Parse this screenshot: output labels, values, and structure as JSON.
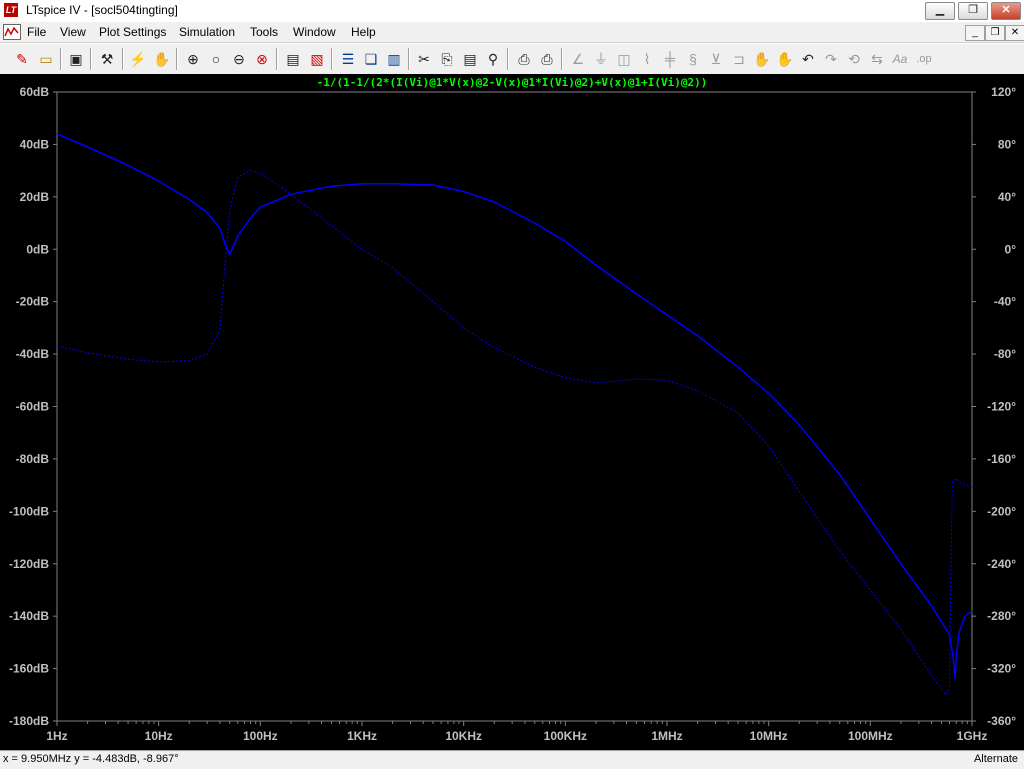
{
  "window": {
    "title": "LTspice IV - [socl504tingting]",
    "logo": "LT",
    "minimize": "▁",
    "maximize": "❐",
    "close": "✕"
  },
  "menu": {
    "file": "File",
    "view": "View",
    "plot_settings": "Plot Settings",
    "simulation": "Simulation",
    "tools": "Tools",
    "window": "Window",
    "help": "Help",
    "mdi_min": "_",
    "mdi_restore": "❐",
    "mdi_close": "✕"
  },
  "toolbar": {
    "icons": [
      "new-schematic-icon",
      "open-icon",
      "save-icon",
      "control-panel-icon",
      "run-icon",
      "halt-icon",
      "zoom-area-icon",
      "zoom-back-icon",
      "zoom-out-icon",
      "zoom-cancel-icon",
      "autorange-icon",
      "pan-icon",
      "tile-horizontal-icon",
      "cascade-icon",
      "tile-vertical-icon",
      "cut-icon",
      "copy-icon",
      "paste-icon",
      "find-icon",
      "print-preview-icon",
      "print-icon",
      "wire-icon",
      "ground-icon",
      "label-net-icon",
      "resistor-icon",
      "capacitor-icon",
      "inductor-icon",
      "diode-icon",
      "component-icon",
      "move-icon",
      "drag-icon",
      "undo-icon",
      "redo-icon",
      "rotate-icon",
      "mirror-icon",
      "text-icon",
      "spice-directive-icon"
    ]
  },
  "plot": {
    "trace_expression": "-1/(1-1/(2*(I(Vi)@1*V(x)@2-V(x)@1*I(Vi)@2)+V(x)@1+I(Vi)@2))",
    "trace_color": "#0000ff",
    "title_color": "#00ff00",
    "background": "#000000",
    "left_axis_labels": [
      "60dB",
      "40dB",
      "20dB",
      "0dB",
      "-20dB",
      "-40dB",
      "-60dB",
      "-80dB",
      "-100dB",
      "-120dB",
      "-140dB",
      "-160dB",
      "-180dB"
    ],
    "right_axis_labels": [
      "120°",
      "80°",
      "40°",
      "0°",
      "-40°",
      "-80°",
      "-120°",
      "-160°",
      "-200°",
      "-240°",
      "-280°",
      "-320°",
      "-360°"
    ],
    "x_axis_labels": [
      "1Hz",
      "10Hz",
      "100Hz",
      "1KHz",
      "10KHz",
      "100KHz",
      "1MHz",
      "10MHz",
      "100MHz",
      "1GHz"
    ]
  },
  "chart_data": {
    "type": "line",
    "title": "-1/(1-1/(2*(I(Vi)@1*V(x)@2-V(x)@1*I(Vi)@2)+V(x)@1+I(Vi)@2))",
    "xscale": "log",
    "xlim": [
      1,
      1000000000
    ],
    "ylim": [
      -180,
      60
    ],
    "y2lim": [
      -360,
      120
    ],
    "xlabel": "",
    "ylabel": "",
    "grid": false,
    "series": [
      {
        "style": "solid",
        "axis": "left",
        "x": [
          1,
          2,
          5,
          10,
          20,
          30,
          40,
          45,
          50,
          60,
          80,
          100,
          200,
          500,
          1000,
          2000,
          5000,
          10000,
          20000,
          50000,
          100000,
          200000,
          500000,
          1000000,
          2000000,
          5000000,
          10000000,
          20000000,
          50000000,
          100000000,
          200000000,
          400000000,
          600000000,
          650000000,
          680000000,
          700000000,
          750000000,
          850000000,
          1000000000
        ],
        "values": [
          44,
          39,
          32,
          26,
          19,
          14,
          8,
          2,
          -2,
          5,
          12,
          16,
          21,
          24,
          25,
          25,
          24.5,
          22,
          18,
          10,
          3,
          -6,
          -17,
          -25,
          -33,
          -45,
          -55,
          -67,
          -86,
          -103,
          -120,
          -136,
          -147,
          -155,
          -164,
          -155,
          -146,
          -140,
          -138
        ]
      },
      {
        "style": "dashed",
        "axis": "right",
        "x": [
          1,
          2,
          5,
          10,
          20,
          30,
          40,
          45,
          50,
          60,
          80,
          100,
          200,
          500,
          1000,
          2000,
          5000,
          10000,
          20000,
          50000,
          100000,
          200000,
          500000,
          1000000,
          2000000,
          5000000,
          10000000,
          20000000,
          50000000,
          100000000,
          200000000,
          400000000,
          550000000,
          600000000,
          620000000,
          640000000,
          700000000,
          750000000,
          1000000000
        ],
        "values": [
          -74,
          -79,
          -84,
          -86,
          -85,
          -80,
          -62,
          -10,
          30,
          55,
          60,
          58,
          42,
          18,
          0,
          -14,
          -40,
          -60,
          -75,
          -90,
          -98,
          -102,
          -99,
          -100,
          -108,
          -125,
          -150,
          -185,
          -230,
          -260,
          -290,
          -325,
          -340,
          -335,
          -250,
          -177,
          -175,
          -178,
          -182
        ]
      }
    ]
  },
  "status": {
    "cursor_readout": "x = 9.950MHz   y = -4.483dB, -8.967°",
    "mode": "Alternate"
  }
}
